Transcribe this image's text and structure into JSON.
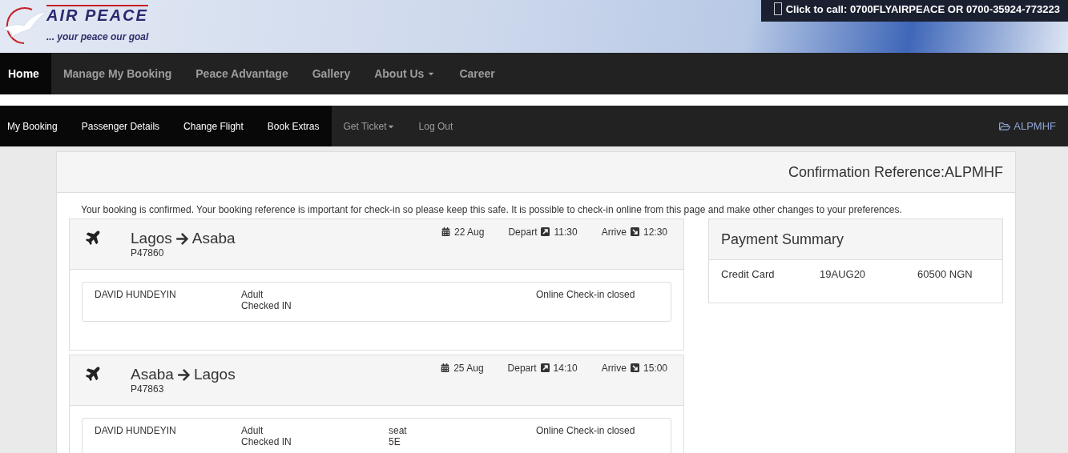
{
  "header": {
    "logo_text": "AIR PEACE",
    "tagline": "... your peace our goal",
    "call_bar": "Click to call: 0700FLYAIRPEACE OR 0700-35924-773223"
  },
  "main_nav": [
    {
      "label": "Home",
      "selected": true,
      "dropdown": false
    },
    {
      "label": "Manage My Booking",
      "selected": false,
      "dropdown": false
    },
    {
      "label": "Peace Advantage",
      "selected": false,
      "dropdown": false
    },
    {
      "label": "Gallery",
      "selected": false,
      "dropdown": false
    },
    {
      "label": "About Us",
      "selected": false,
      "dropdown": true
    },
    {
      "label": "Career",
      "selected": false,
      "dropdown": false
    }
  ],
  "sub_nav": [
    {
      "label": "My Booking",
      "highlighted": true,
      "dropdown": false
    },
    {
      "label": "Passenger Details",
      "highlighted": true,
      "dropdown": false
    },
    {
      "label": "Change Flight",
      "highlighted": true,
      "dropdown": false
    },
    {
      "label": "Book Extras",
      "highlighted": true,
      "dropdown": false
    },
    {
      "label": "Get Ticket",
      "highlighted": false,
      "dropdown": true
    },
    {
      "label": "Log Out",
      "highlighted": false,
      "dropdown": false
    }
  ],
  "booking_code": "ALPMHF",
  "confirmation_title": "Confirmation Reference:ALPMHF",
  "notice": "Your booking is confirmed. Your booking reference is important for check-in so please keep this safe. It is possible to check-in online from this page and make other changes to your preferences.",
  "flights": [
    {
      "from": "Lagos",
      "to": "Asaba",
      "flight_no": "P47860",
      "date": "22 Aug",
      "depart_label": "Depart",
      "depart_time": "11:30",
      "arrive_label": "Arrive",
      "arrive_time": "12:30",
      "passengers": [
        {
          "name": "DAVID HUNDEYIN",
          "type": "Adult",
          "status": "Checked IN",
          "checkin": "Online Check-in closed"
        }
      ]
    },
    {
      "from": "Asaba",
      "to": "Lagos",
      "flight_no": "P47863",
      "date": "25 Aug",
      "depart_label": "Depart",
      "depart_time": "14:10",
      "arrive_label": "Arrive",
      "arrive_time": "15:00",
      "passengers": [
        {
          "name": "DAVID HUNDEYIN",
          "type": "Adult",
          "status": "Checked IN",
          "seat_label": "seat",
          "seat": "5E",
          "checkin": "Online Check-in closed"
        }
      ]
    }
  ],
  "payment_summary": {
    "title": "Payment Summary",
    "rows": [
      {
        "method": "Credit Card",
        "date": "19AUG20",
        "amount": "60500 NGN"
      }
    ]
  }
}
